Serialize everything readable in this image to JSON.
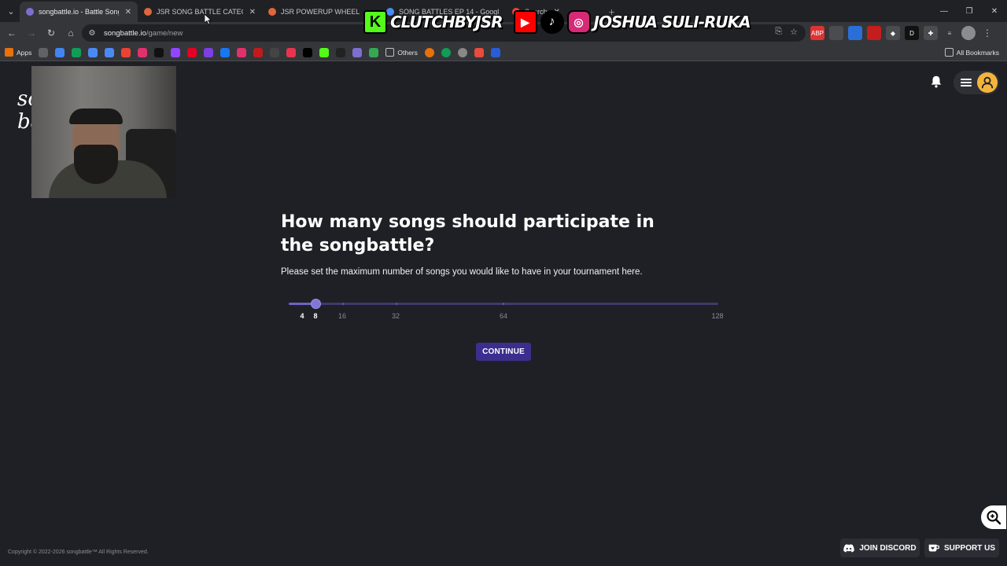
{
  "browser": {
    "tabs": [
      {
        "label": "songbattle.io - Battle Songs ag",
        "active": true,
        "favicon_color": "#7b6fd0"
      },
      {
        "label": "JSR SONG BATTLE CATEGORY",
        "active": false,
        "favicon_color": "#e0663c"
      },
      {
        "label": "JSR POWERUP WHEEL",
        "active": false,
        "favicon_color": "#e0663c"
      },
      {
        "label": "SONG BATTLES EP 14 - Googl",
        "active": false,
        "favicon_color": "#4a8af4"
      },
      {
        "label": "Search",
        "active": false,
        "favicon_color": "#ea4335"
      }
    ],
    "url_host": "songbattle.io",
    "url_path": "/game/new",
    "bookmarks_apps_label": "Apps",
    "bookmarks_folder_label": "Others",
    "all_bookmarks_label": "All Bookmarks",
    "extensions": [
      "ABP",
      "D"
    ]
  },
  "overlay": {
    "kick_name": "CLUTCHBYJSR",
    "kick_letter": "K",
    "social_name": "JOSHUA SULI-RUKA"
  },
  "page": {
    "logo_text": "song battle",
    "question": "How many songs should participate in the songbattle?",
    "subtext": "Please set the maximum number of songs you would like to have in your tournament here.",
    "slider": {
      "ticks": [
        "4",
        "8",
        "16",
        "32",
        "64",
        "128"
      ],
      "selected_value": 8,
      "active_ticks": [
        "4",
        "8"
      ]
    },
    "continue_label": "CONTINUE",
    "copyright": "Copyright © 2022-2026 songbattle™ All Rights Reserved.",
    "join_discord_label": "JOIN DISCORD",
    "support_us_label": "SUPPORT US"
  },
  "colors": {
    "accent": "#3a2f8e",
    "slider_fill": "#6d63c4",
    "avatar": "#f4b43c",
    "background": "#1f2025"
  }
}
